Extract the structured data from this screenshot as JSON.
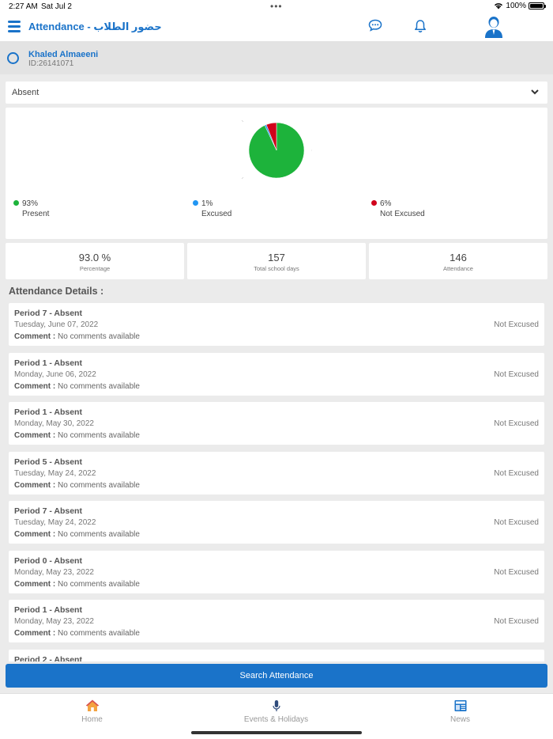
{
  "status_bar": {
    "time": "2:27 AM",
    "date": "Sat Jul 2",
    "battery": "100%"
  },
  "header": {
    "title": "Attendance - حضور الطلاب"
  },
  "student": {
    "name": "Khaled  Almaeeni",
    "id": "ID:26141071"
  },
  "filter": {
    "selected": "Absent"
  },
  "chart_data": {
    "type": "pie",
    "slices": [
      {
        "label": "Present",
        "value": 93,
        "display": "93%",
        "color": "#1db33b"
      },
      {
        "label": "Excused",
        "value": 1,
        "display": "1%",
        "color": "#2196f3"
      },
      {
        "label": "Not Excused",
        "value": 6,
        "display": "6%",
        "color": "#d0021b"
      }
    ]
  },
  "stats": [
    {
      "value": "93.0 %",
      "caption": "Percentage"
    },
    {
      "value": "157",
      "caption": "Total school days"
    },
    {
      "value": "146",
      "caption": "Attendance"
    }
  ],
  "details_title": "Attendance Details :",
  "comment_label": "Comment :",
  "records": [
    {
      "period": "Period 7 - Absent",
      "date": "Tuesday, June 07, 2022",
      "comment": "No comments available",
      "status": "Not Excused"
    },
    {
      "period": "Period 1 - Absent",
      "date": "Monday, June 06, 2022",
      "comment": "No comments available",
      "status": "Not Excused"
    },
    {
      "period": "Period 1 - Absent",
      "date": "Monday, May 30, 2022",
      "comment": "No comments available",
      "status": "Not Excused"
    },
    {
      "period": "Period 5 - Absent",
      "date": "Tuesday, May 24, 2022",
      "comment": "No comments available",
      "status": "Not Excused"
    },
    {
      "period": "Period 7 - Absent",
      "date": "Tuesday, May 24, 2022",
      "comment": "No comments available",
      "status": "Not Excused"
    },
    {
      "period": "Period 0 - Absent",
      "date": "Monday, May 23, 2022",
      "comment": "No comments available",
      "status": "Not Excused"
    },
    {
      "period": "Period 1 - Absent",
      "date": "Monday, May 23, 2022",
      "comment": "No comments available",
      "status": "Not Excused"
    },
    {
      "period": "Period 2 - Absent",
      "date": "",
      "comment": "",
      "status": ""
    }
  ],
  "search_button": "Search Attendance",
  "tabs": [
    {
      "label": "Home",
      "icon": "home-icon"
    },
    {
      "label": "Events & Holidays",
      "icon": "microphone-icon"
    },
    {
      "label": "News",
      "icon": "news-icon"
    }
  ],
  "colors": {
    "accent": "#1a73c9",
    "present": "#1db33b",
    "excused": "#2196f3",
    "not_excused": "#d0021b"
  }
}
